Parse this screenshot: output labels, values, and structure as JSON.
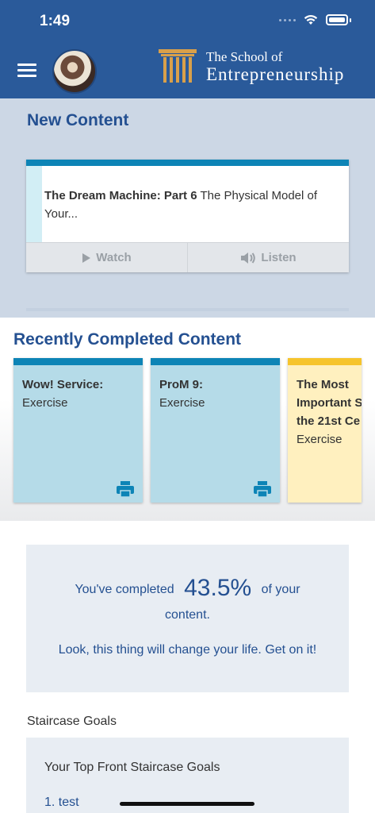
{
  "status_bar": {
    "time": "1:49"
  },
  "header": {
    "menu_icon": "hamburger-menu-icon",
    "logo_line1": "The School of",
    "logo_line2": "Entrepreneurship",
    "brand_color": "#2a5a9a"
  },
  "new_content": {
    "title": "New Content",
    "card": {
      "title_bold": "The Dream Machine: Part 6",
      "title_rest": " The Physical Model of Your...",
      "watch_label": "Watch",
      "listen_label": "Listen"
    }
  },
  "recent": {
    "title": "Recently Completed Content",
    "cards": [
      {
        "title": "Wow! Service:",
        "type": "Exercise"
      },
      {
        "title": "ProM 9:",
        "type": "Exercise"
      },
      {
        "title": "The Most\nImportant S\nthe 21st Ce",
        "type": "Exercise"
      }
    ]
  },
  "progress": {
    "prefix": "You've completed",
    "percent": "43.5%",
    "suffix": "of your",
    "line2": "content.",
    "line3": "Look, this thing will change your life. Get on it!"
  },
  "staircase": {
    "label": "Staircase Goals",
    "heading": "Your Top Front Staircase Goals",
    "items": [
      "1. test"
    ]
  }
}
